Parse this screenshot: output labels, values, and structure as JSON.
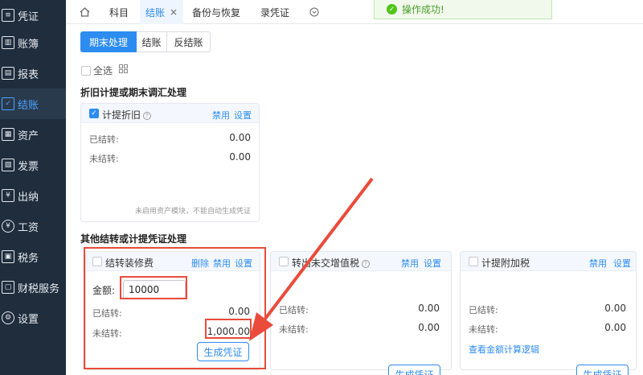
{
  "sidebar": {
    "items": [
      {
        "label": "凭证",
        "icon": "voucher-icon",
        "active": false
      },
      {
        "label": "账簿",
        "icon": "ledger-icon",
        "active": false
      },
      {
        "label": "报表",
        "icon": "report-icon",
        "active": false
      },
      {
        "label": "结账",
        "icon": "closing-icon",
        "active": true
      },
      {
        "label": "资产",
        "icon": "asset-icon",
        "active": false
      },
      {
        "label": "发票",
        "icon": "invoice-icon",
        "active": false
      },
      {
        "label": "出纳",
        "icon": "cashier-icon",
        "active": false
      },
      {
        "label": "工资",
        "icon": "salary-icon",
        "active": false
      },
      {
        "label": "税务",
        "icon": "tax-icon",
        "active": false
      },
      {
        "label": "财税服务",
        "icon": "service-icon",
        "active": false
      },
      {
        "label": "设置",
        "icon": "gear-icon",
        "active": false
      }
    ]
  },
  "tabs": {
    "home_icon": "home-icon",
    "items": [
      {
        "label": "科目"
      },
      {
        "label": "结账",
        "close": "×"
      },
      {
        "label": "备份与恢复"
      },
      {
        "label": "录凭证"
      }
    ],
    "more_icon": "chevron-down-icon"
  },
  "toast": {
    "icon": "check-circle-icon",
    "text": "操作成功!"
  },
  "segments": [
    "期末处理",
    "结账",
    "反结账"
  ],
  "select_all": {
    "label": "全选",
    "checked": false
  },
  "section1": {
    "title": "折旧计提或期末调汇处理",
    "card": {
      "title": "计提折旧",
      "checked": true,
      "actions": [
        "禁用",
        "设置"
      ],
      "rows": [
        {
          "label": "已结转:",
          "value": "0.00"
        },
        {
          "label": "未结转:",
          "value": "0.00"
        }
      ],
      "note": "未启用资产模块，不能自动生成凭证"
    }
  },
  "section2": {
    "title": "其他结转或计提凭证处理",
    "cards": [
      {
        "title": "结转装修费",
        "actions": [
          "删除",
          "禁用",
          "设置"
        ],
        "amount_label": "金额:",
        "amount_value": "10000",
        "rows": [
          {
            "label": "已结转:",
            "value": "0.00"
          },
          {
            "label": "未结转:",
            "value": "1,000.00"
          }
        ],
        "button": "生成凭证"
      },
      {
        "title": "转出未交增值税",
        "actions": [
          "禁用",
          "设置"
        ],
        "rows": [
          {
            "label": "已结转:",
            "value": "0.00"
          },
          {
            "label": "未结转:",
            "value": "0.00"
          }
        ],
        "button": "生成凭证"
      },
      {
        "title": "计提附加税",
        "actions": [
          "禁用",
          "设置"
        ],
        "rows": [
          {
            "label": "已结转:",
            "value": "0.00"
          },
          {
            "label": "未结转:",
            "value": "0.00"
          }
        ],
        "link": "查看金额计算逻辑",
        "button": "生成凭证"
      }
    ]
  },
  "colors": {
    "accent": "#2d8cf0",
    "highlight": "#e84a3a",
    "sidebar": "#1f2d3d",
    "success": "#52c41a"
  }
}
